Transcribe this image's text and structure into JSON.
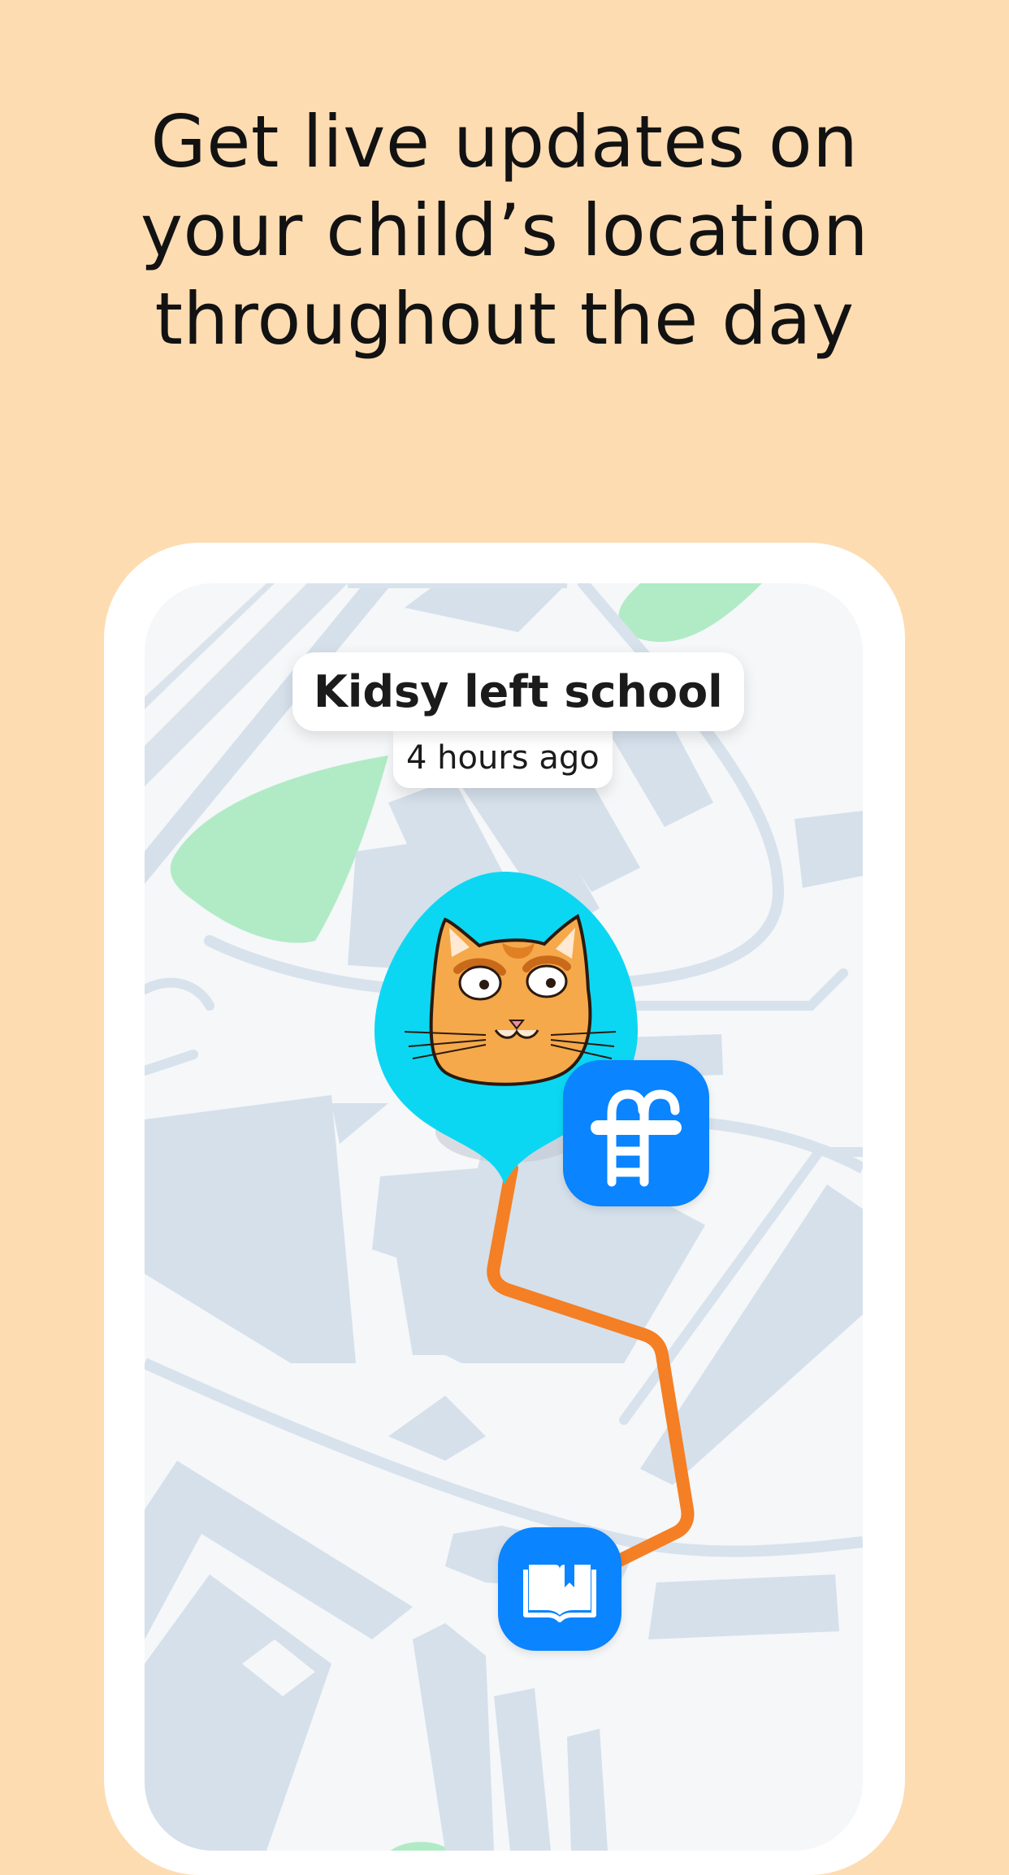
{
  "headline": {
    "line1": "Get live updates on",
    "line2": "your child’s location",
    "line3": "throughout the day"
  },
  "notification": {
    "title": "Kidsy left school",
    "time": "4 hours ago"
  },
  "map": {
    "avatar_icon": "cat-avatar-icon",
    "places": [
      {
        "icon": "pool-ladder-icon"
      },
      {
        "icon": "book-icon"
      }
    ],
    "route_color": "#F47F24",
    "pin_color": "#0CD7F2",
    "place_color": "#0A84FF"
  }
}
